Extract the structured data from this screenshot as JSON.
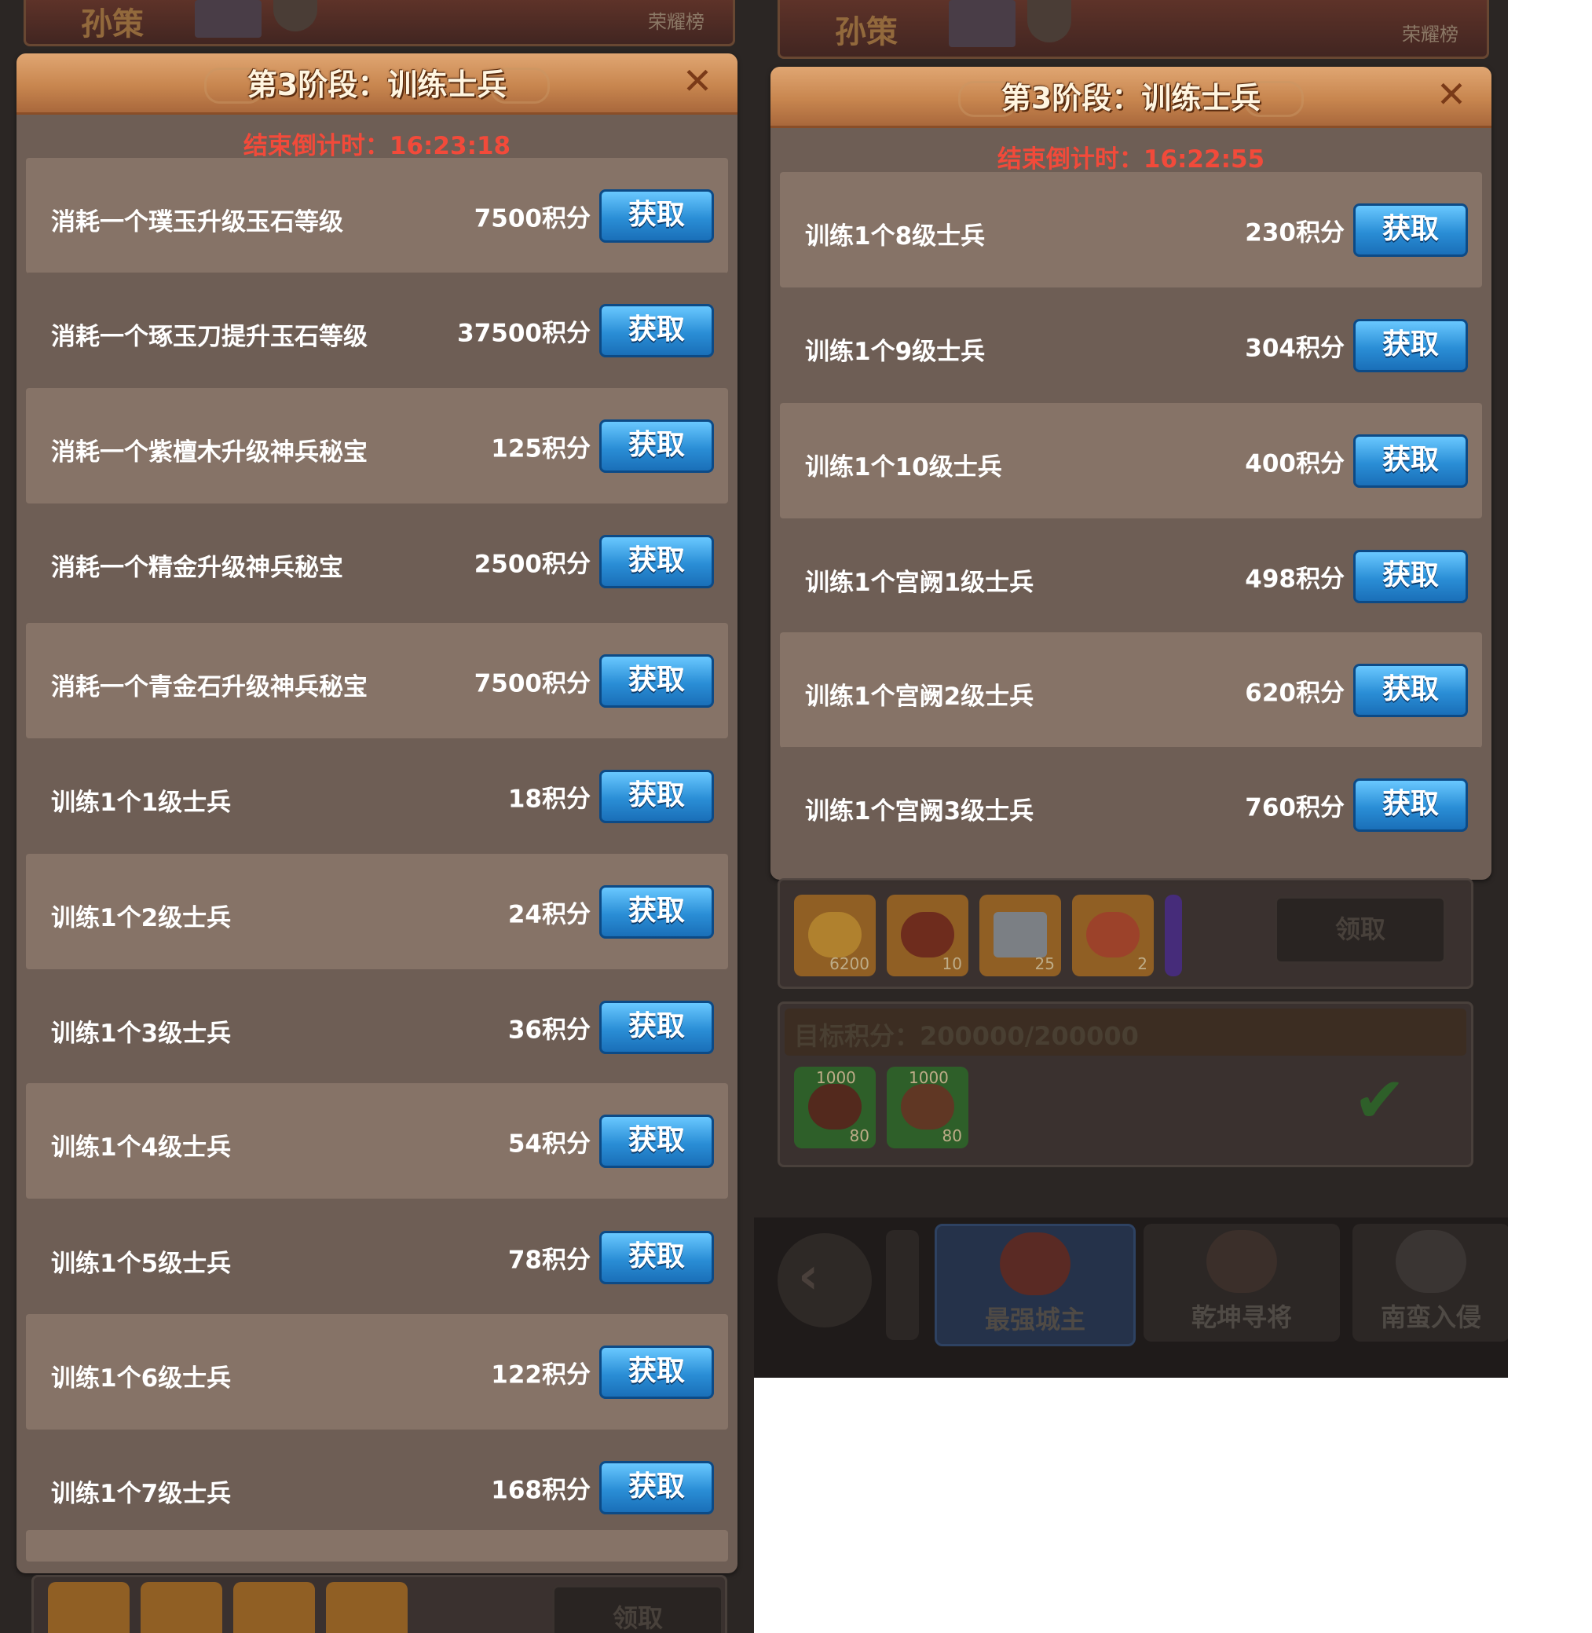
{
  "left": {
    "top_strip": {
      "name": "孙策",
      "label": "荣耀榜"
    },
    "panel": {
      "title": "第3阶段：训练士兵",
      "close": "✕",
      "countdown": "结束倒计时：16:23:18",
      "rows": [
        {
          "label": "消耗一个璞玉升级玉石等级",
          "points": "7500积分",
          "button": "获取"
        },
        {
          "label": "消耗一个琢玉刀提升玉石等级",
          "points": "37500积分",
          "button": "获取"
        },
        {
          "label": "消耗一个紫檀木升级神兵秘宝",
          "points": "125积分",
          "button": "获取"
        },
        {
          "label": "消耗一个精金升级神兵秘宝",
          "points": "2500积分",
          "button": "获取"
        },
        {
          "label": "消耗一个青金石升级神兵秘宝",
          "points": "7500积分",
          "button": "获取"
        },
        {
          "label": "训练1个1级士兵",
          "points": "18积分",
          "button": "获取"
        },
        {
          "label": "训练1个2级士兵",
          "points": "24积分",
          "button": "获取"
        },
        {
          "label": "训练1个3级士兵",
          "points": "36积分",
          "button": "获取"
        },
        {
          "label": "训练1个4级士兵",
          "points": "54积分",
          "button": "获取"
        },
        {
          "label": "训练1个5级士兵",
          "points": "78积分",
          "button": "获取"
        },
        {
          "label": "训练1个6级士兵",
          "points": "122积分",
          "button": "获取"
        },
        {
          "label": "训练1个7级士兵",
          "points": "168积分",
          "button": "获取"
        }
      ]
    },
    "claim_button": "领取"
  },
  "right": {
    "top_strip": {
      "name": "孙策",
      "label": "荣耀榜"
    },
    "panel": {
      "title": "第3阶段：训练士兵",
      "close": "✕",
      "countdown": "结束倒计时：16:22:55",
      "rows": [
        {
          "label": "训练1个8级士兵",
          "points": "230积分",
          "button": "获取"
        },
        {
          "label": "训练1个9级士兵",
          "points": "304积分",
          "button": "获取"
        },
        {
          "label": "训练1个10级士兵",
          "points": "400积分",
          "button": "获取"
        },
        {
          "label": "训练1个宫阙1级士兵",
          "points": "498积分",
          "button": "获取"
        },
        {
          "label": "训练1个宫阙2级士兵",
          "points": "620积分",
          "button": "获取"
        },
        {
          "label": "训练1个宫阙3级士兵",
          "points": "760积分",
          "button": "获取"
        }
      ]
    },
    "rewards": {
      "items": [
        {
          "icon": "gold-ingot-icon",
          "count": "6200"
        },
        {
          "icon": "meat-icon",
          "count": "10"
        },
        {
          "icon": "silver-plate-icon",
          "count": "25"
        },
        {
          "icon": "medal-icon",
          "count": "2"
        }
      ],
      "claim_button": "领取"
    },
    "target": {
      "label": "目标积分：200000/200000",
      "items": [
        {
          "icon": "meat-speedup-icon",
          "top": "1000",
          "count": "80"
        },
        {
          "icon": "wood-speedup-icon",
          "top": "1000",
          "count": "80"
        }
      ],
      "check": "✔"
    },
    "nav": {
      "back": "‹",
      "tabs": [
        "最强城主",
        "乾坤寻将",
        "南蛮入侵"
      ]
    }
  }
}
